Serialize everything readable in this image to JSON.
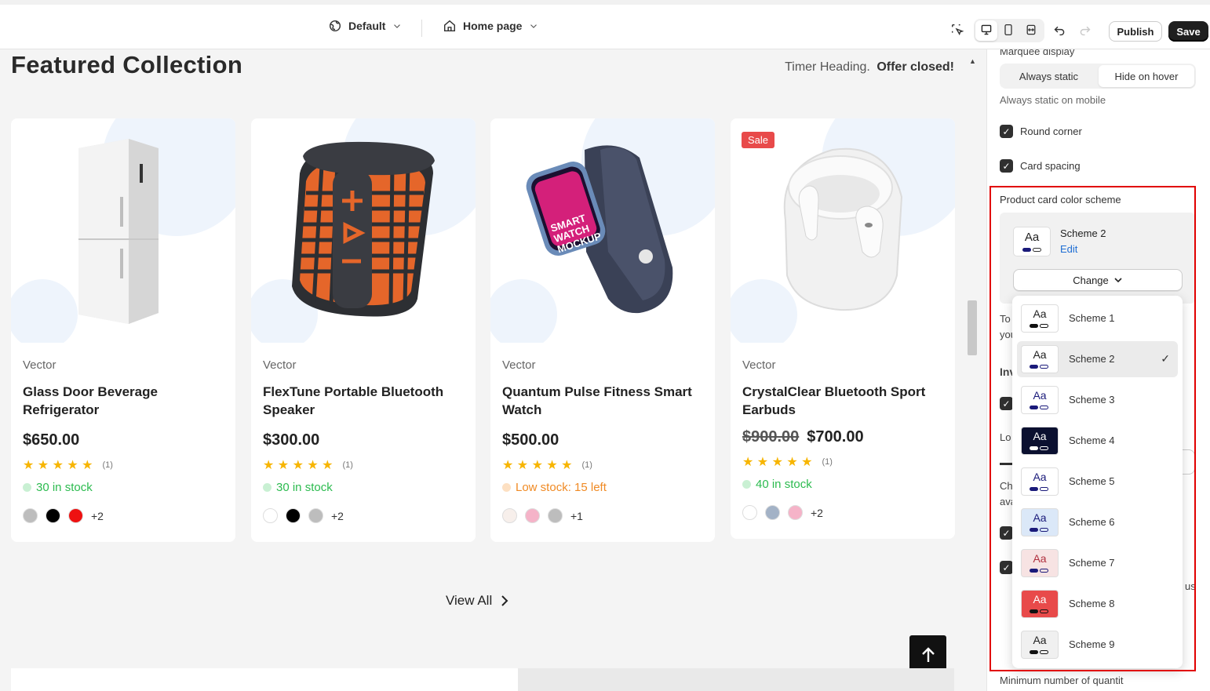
{
  "topbar": {
    "theme_label": "Default",
    "page_label": "Home page",
    "publish_label": "Publish",
    "save_label": "Save"
  },
  "preview": {
    "section_title": "Featured Collection",
    "timer_heading": "Timer Heading.",
    "timer_status": "Offer closed!",
    "view_all": "View All",
    "products": [
      {
        "vendor": "Vector",
        "name": "Glass Door Beverage Refrigerator",
        "compare_price": "",
        "price": "$650.00",
        "stars": "★ ★ ★ ★ ★",
        "reviews": "(1)",
        "stock": "30 in stock",
        "stock_color": "#2cbb4f",
        "swatches": [
          "#bdbdbd",
          "#000000",
          "#ee1111"
        ],
        "more": "+2",
        "sale": ""
      },
      {
        "vendor": "Vector",
        "name": "FlexTune Portable Bluetooth Speaker",
        "compare_price": "",
        "price": "$300.00",
        "stars": "★ ★ ★ ★ ★",
        "reviews": "(1)",
        "stock": "30 in stock",
        "stock_color": "#2cbb4f",
        "swatches": [
          "#ffffff",
          "#000000",
          "#bdbdbd"
        ],
        "more": "+2",
        "sale": ""
      },
      {
        "vendor": "Vector",
        "name": "Quantum Pulse Fitness Smart Watch",
        "compare_price": "",
        "price": "$500.00",
        "stars": "★ ★ ★ ★ ★",
        "reviews": "(1)",
        "stock": "Low stock: 15 left",
        "stock_color": "#f08a24",
        "swatches": [
          "#f7efeb",
          "#f5b3c8",
          "#bdbdbd"
        ],
        "more": "+1",
        "sale": ""
      },
      {
        "vendor": "Vector",
        "name": "CrystalClear Bluetooth Sport Earbuds",
        "compare_price": "$900.00",
        "price": "$700.00",
        "stars": "★ ★ ★ ★ ★",
        "reviews": "(1)",
        "stock": "40 in stock",
        "stock_color": "#2cbb4f",
        "swatches": [
          "#ffffff",
          "#a3b2c6",
          "#f5b3c8"
        ],
        "more": "+2",
        "sale": "Sale"
      }
    ]
  },
  "panel": {
    "marquee_label": "Marquee display",
    "seg_a": "Always static",
    "seg_b": "Hide on hover",
    "seg_help": "Always static on mobile",
    "round_corner": "Round corner",
    "card_spacing": "Card spacing",
    "color_scheme_label": "Product card color scheme",
    "current_scheme": "Scheme 2",
    "edit_label": "Edit",
    "change_label": "Change",
    "partial_texts": [
      "To",
      "you",
      "Inv",
      "Lo",
      "Ch",
      "ava",
      "us",
      "Minimum number of quantit"
    ]
  },
  "schemes": [
    {
      "name": "Scheme 1",
      "bg": "#ffffff",
      "fg": "#222222",
      "pill": "#111111",
      "selected": false
    },
    {
      "name": "Scheme 2",
      "bg": "#ffffff",
      "fg": "#222222",
      "pill": "#1a1a7a",
      "selected": true
    },
    {
      "name": "Scheme 3",
      "bg": "#ffffff",
      "fg": "#1a1a7a",
      "pill": "#1a1a7a",
      "selected": false
    },
    {
      "name": "Scheme 4",
      "bg": "#0b1030",
      "fg": "#ffffff",
      "pill": "#ffffff",
      "selected": false
    },
    {
      "name": "Scheme 5",
      "bg": "#ffffff",
      "fg": "#1a1a7a",
      "pill": "#1a1a7a",
      "selected": false
    },
    {
      "name": "Scheme 6",
      "bg": "#dbe8f8",
      "fg": "#1a1a7a",
      "pill": "#1a1a7a",
      "selected": false
    },
    {
      "name": "Scheme 7",
      "bg": "#f7e3e3",
      "fg": "#b0303f",
      "pill": "#1a1a7a",
      "selected": false
    },
    {
      "name": "Scheme 8",
      "bg": "#e84a4a",
      "fg": "#ffffff",
      "pill": "#111111",
      "selected": false
    },
    {
      "name": "Scheme 9",
      "bg": "#f0f0f0",
      "fg": "#222222",
      "pill": "#111111",
      "selected": false
    }
  ],
  "colors": {
    "accent_red": "#e10000",
    "link": "#1f6ed4"
  }
}
